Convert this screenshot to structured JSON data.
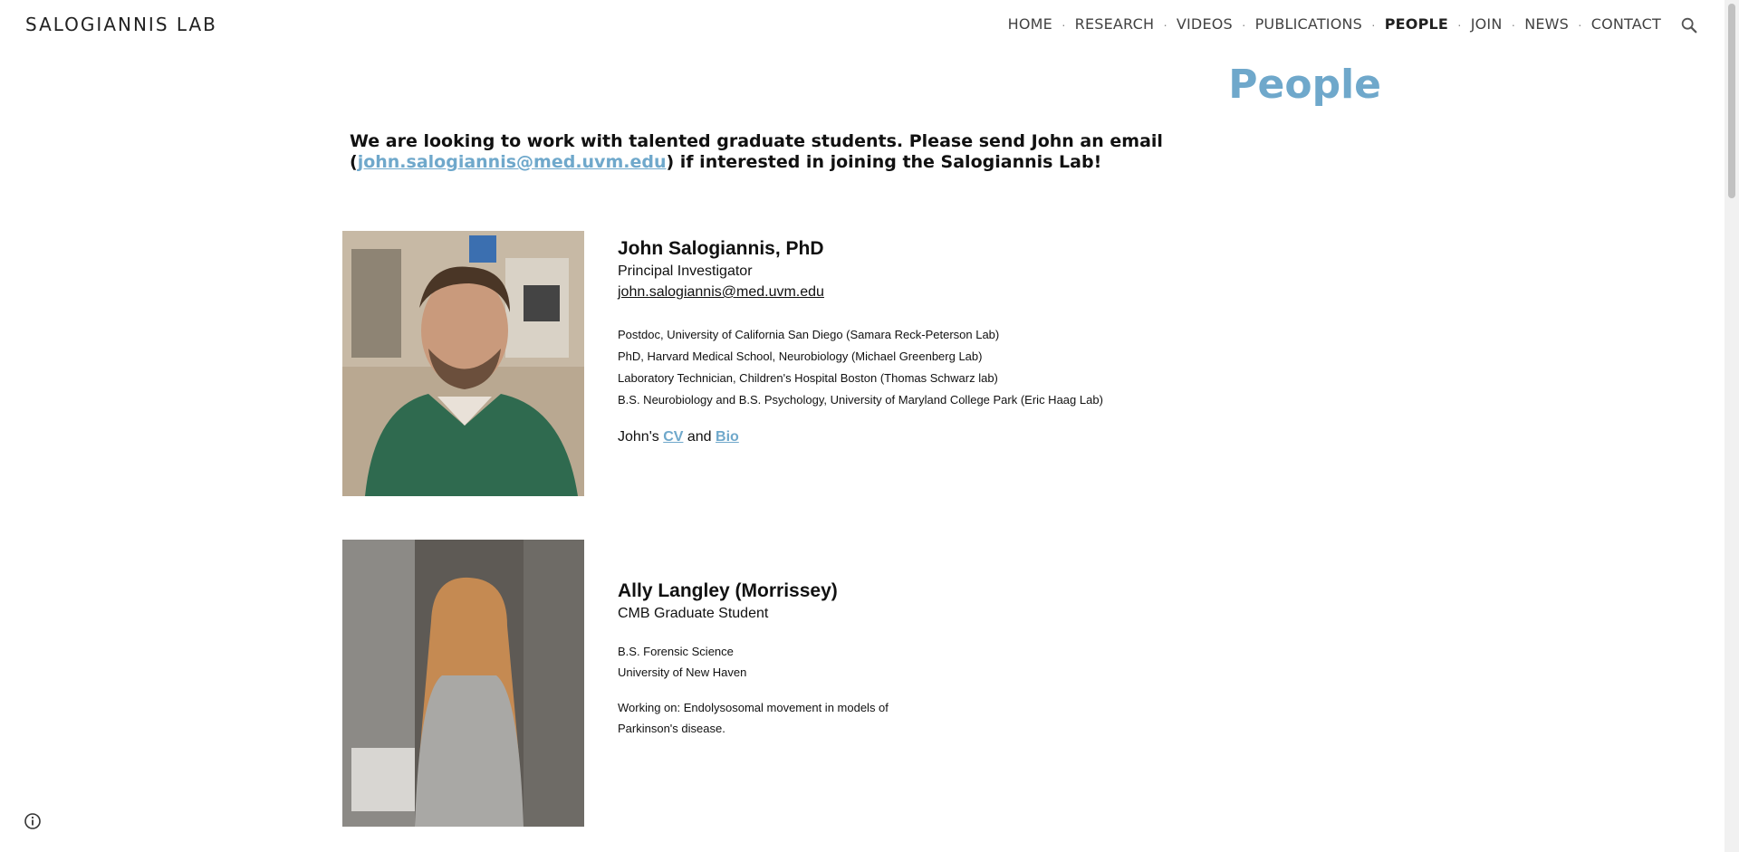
{
  "header": {
    "site_title": "SALOGIANNIS LAB",
    "nav": [
      {
        "label": "HOME",
        "active": false
      },
      {
        "label": "RESEARCH",
        "active": false
      },
      {
        "label": "VIDEOS",
        "active": false
      },
      {
        "label": "PUBLICATIONS",
        "active": false
      },
      {
        "label": "PEOPLE",
        "active": true
      },
      {
        "label": "JOIN",
        "active": false
      },
      {
        "label": "NEWS",
        "active": false
      },
      {
        "label": "CONTACT",
        "active": false
      }
    ],
    "separator": "·",
    "search_icon": "search-icon"
  },
  "page": {
    "title": "People",
    "intro_before": "We are looking to work with talented graduate students. Please send John an email (",
    "intro_email": "john.salogiannis@med.uvm.edu",
    "intro_after": ") if interested in joining the Salogiannis Lab!",
    "accent_color": "#6fa8cb"
  },
  "people": [
    {
      "name": "John Salogiannis, PhD",
      "role": "Principal Investigator",
      "email": "john.salogiannis@med.uvm.edu",
      "history": [
        "Postdoc, University of California San Diego (Samara Reck-Peterson Lab)",
        "PhD, Harvard Medical School, Neurobiology (Michael Greenberg Lab)",
        "Laboratory Technician, Children's Hospital Boston (Thomas Schwarz lab)",
        "B.S. Neurobiology and B.S. Psychology, University of Maryland College Park (Eric Haag Lab)"
      ],
      "links_prefix": "John's ",
      "cv_label": "CV",
      "links_and": " and ",
      "bio_label": "Bio"
    },
    {
      "name": "Ally Langley (Morrissey)",
      "role": "CMB Graduate Student",
      "degree_line1": "B.S. Forensic Science",
      "degree_line2": "University of New Haven",
      "working_line1": "Working on: Endolysosomal movement in models of",
      "working_line2": "Parkinson's disease."
    }
  ],
  "footer": {
    "info_icon": "info-icon"
  }
}
